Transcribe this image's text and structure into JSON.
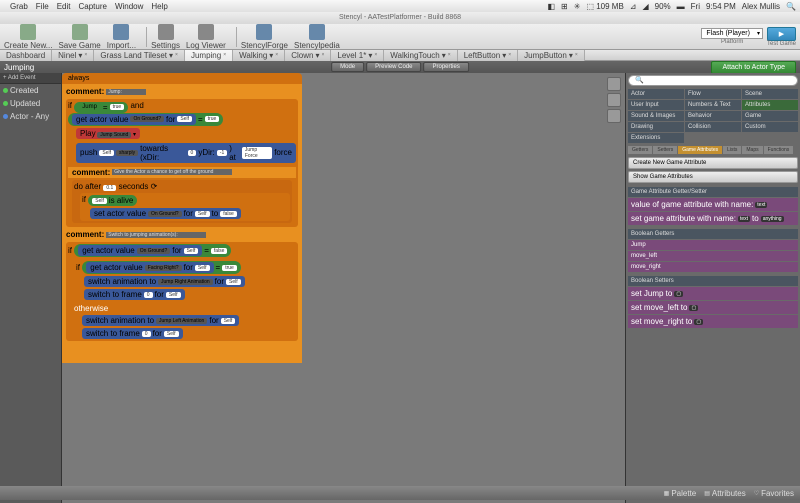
{
  "menubar": {
    "app": "Grab",
    "items": [
      "File",
      "Edit",
      "Capture",
      "Window",
      "Help"
    ],
    "status": {
      "battery": "90%",
      "day": "Fri",
      "time": "9:54 PM",
      "user": "Alex Mullis"
    }
  },
  "title": "Stencyl - AATestPlatformer - Build 8868",
  "toolbar": {
    "items": [
      "Create New...",
      "Save Game",
      "Import...",
      "Settings",
      "Log Viewer",
      "StencylForge",
      "Stencylpedia"
    ],
    "platform_label": "Flash (Player)",
    "platform_sub": "Platform",
    "test": "Test Game"
  },
  "tabs": [
    "Dashboard",
    "Ninel",
    "Grass Land Tileset",
    "Jumping",
    "Walking",
    "Clown",
    "Level 1*",
    "WalkingTouch",
    "LeftButton",
    "JumpButton"
  ],
  "active_tab": "Jumping",
  "subheader": {
    "title": "Jumping",
    "btns": [
      "Mode",
      "Preview Code",
      "Properties"
    ],
    "attach": "Attach to Actor Type"
  },
  "sidebar": {
    "add": "+ Add Event",
    "items": [
      {
        "label": "Created",
        "color": "g"
      },
      {
        "label": "Updated",
        "color": "g"
      },
      {
        "label": "Actor - Any",
        "color": "b"
      }
    ]
  },
  "blocks": {
    "always": "always",
    "comment1": "Jump:",
    "if1": {
      "kw": "if",
      "jump": "Jump",
      "eq": "=",
      "true": "true",
      "and": "and",
      "get": "get actor value",
      "key": "On Ground?",
      "for": "for",
      "self": "Self",
      "eq2": "=",
      "true2": "true"
    },
    "play": {
      "play": "Play",
      "sound": "Jump Sound"
    },
    "push": {
      "push": "push",
      "self": "Self",
      "sharply": "sharply",
      "towards": "towards (xDir:",
      "x": "0",
      "ydir": "yDir:",
      "y": "-1",
      ") at": ") at",
      "force": "Jump Force",
      "force2": "force"
    },
    "comment2": "Give the Actor a chance to get off the ground",
    "doafter": {
      "do": "do after",
      "n": "0.1",
      "sec": "seconds"
    },
    "if2": {
      "if": "if",
      "self": "Self",
      "alive": "is alive"
    },
    "set1": {
      "set": "set actor value",
      "key": "On Ground?",
      "for": "for",
      "self": "Self",
      "to": "to",
      "false": "false"
    },
    "comment3": "Switch to jumping animation(s):",
    "if3": {
      "if": "if",
      "get": "get actor value",
      "key": "On Ground?",
      "for": "for",
      "self": "Self",
      "eq": "=",
      "false": "false"
    },
    "if4": {
      "if": "if",
      "get": "get actor value",
      "key": "Facing Right?",
      "for": "for",
      "self": "Self",
      "eq": "=",
      "true": "true"
    },
    "switch1": {
      "switch": "switch animation to",
      "anim": "Jump Right Animation",
      "for": "for",
      "self": "Self"
    },
    "frame1": {
      "switch": "switch to frame",
      "n": "0",
      "for": "for",
      "self": "Self"
    },
    "otherwise": "otherwise",
    "switch2": {
      "switch": "switch animation to",
      "anim": "Jump Left Animation",
      "for": "for",
      "self": "Self"
    },
    "frame2": {
      "switch": "switch to frame",
      "n": "0",
      "for": "for",
      "self": "Self"
    }
  },
  "rpanel": {
    "cats": [
      [
        "Actor",
        "Flow",
        "Scene"
      ],
      [
        "User Input",
        "Numbers & Text",
        "Attributes"
      ],
      [
        "Sound & Images",
        "Behavior",
        "Game"
      ],
      [
        "Drawing",
        "Collision",
        "Custom"
      ],
      [
        "Extensions",
        "",
        ""
      ]
    ],
    "subtabs": [
      "Getters",
      "Setters",
      "Game Attributes",
      "Lists",
      "Maps",
      "Functions"
    ],
    "btns": [
      "Create New Game Attribute",
      "Show Game Attributes"
    ],
    "sec1": {
      "hdr": "Game Attribute Getter/Setter",
      "items": [
        {
          "t": "value of game attribute with name:",
          "tag": "text"
        },
        {
          "t": "set game attribute with name:",
          "tag": "text",
          "to": "to",
          "tag2": "anything"
        }
      ]
    },
    "sec2": {
      "hdr": "Boolean Getters",
      "items": [
        "Jump",
        "move_left",
        "move_right"
      ]
    },
    "sec3": {
      "hdr": "Boolean Setters",
      "items": [
        {
          "t": "set Jump to"
        },
        {
          "t": "set move_left to"
        },
        {
          "t": "set move_right to"
        }
      ]
    }
  },
  "bottom": {
    "palette": "Palette",
    "attributes": "Attributes",
    "favorites": "Favorites"
  }
}
